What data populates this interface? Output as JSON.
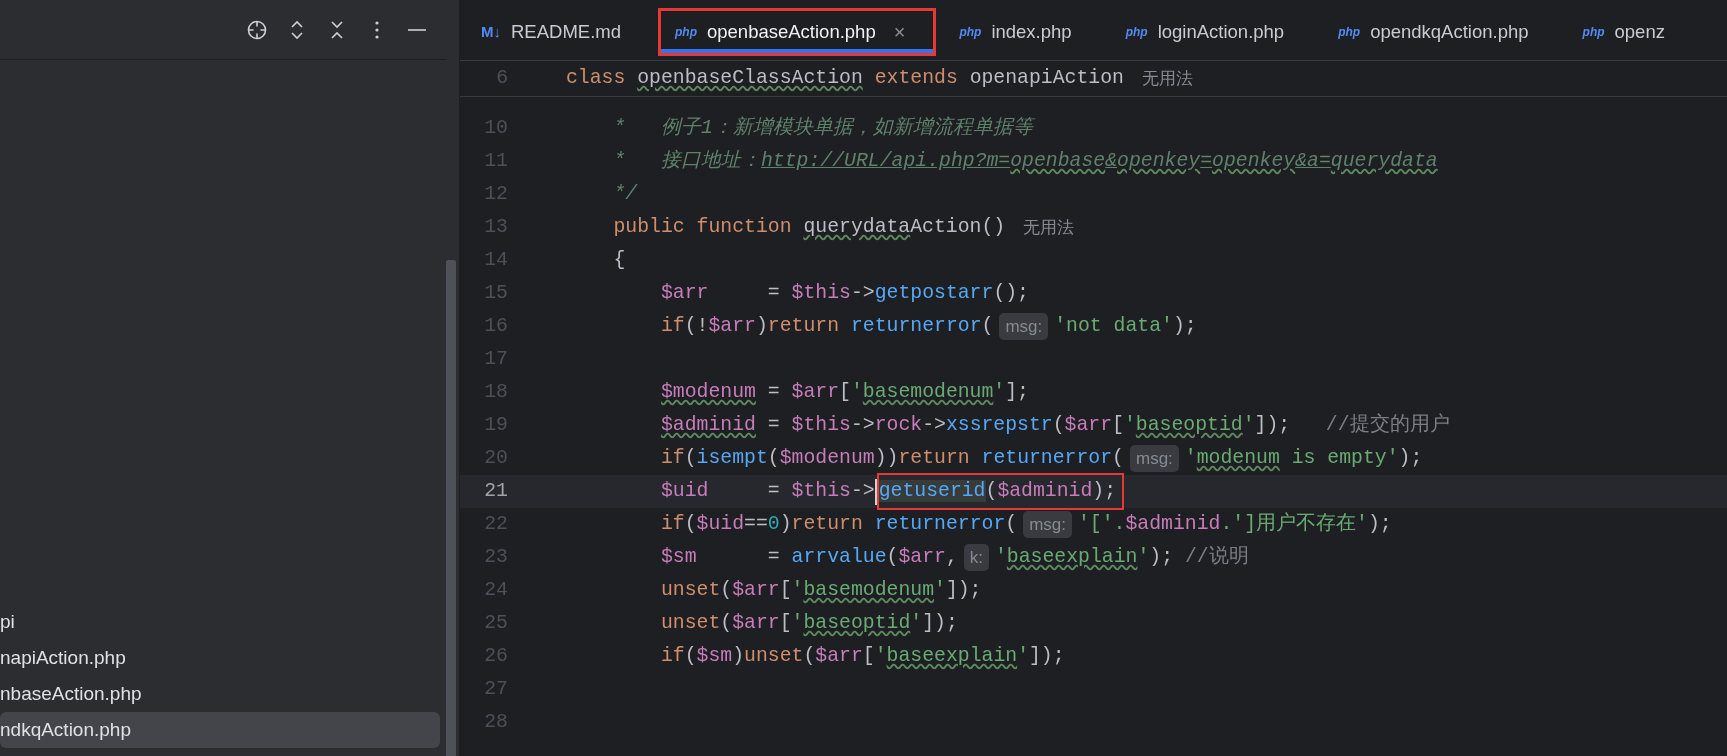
{
  "sidebar": {
    "items": [
      {
        "label": "pi",
        "selected": false
      },
      {
        "label": "napiAction.php",
        "selected": false
      },
      {
        "label": "nbaseAction.php",
        "selected": false
      },
      {
        "label": "ndkqAction.php",
        "selected": true
      }
    ]
  },
  "tabs": [
    {
      "badge": "M↓",
      "label": "README.md",
      "selected": false,
      "highlighted": false
    },
    {
      "badge": "php",
      "label": "openbaseAction.php",
      "selected": true,
      "highlighted": true,
      "close": "×"
    },
    {
      "badge": "php",
      "label": "index.php",
      "selected": false,
      "highlighted": false
    },
    {
      "badge": "php",
      "label": "loginAction.php",
      "selected": false,
      "highlighted": false
    },
    {
      "badge": "php",
      "label": "opendkqAction.php",
      "selected": false,
      "highlighted": false
    },
    {
      "badge": "php",
      "label": "openz",
      "selected": false,
      "highlighted": false
    }
  ],
  "editor": {
    "sticky_line": {
      "number": "6",
      "segments": [
        {
          "kind": "code",
          "tokens": [
            {
              "kind": "keyword",
              "text": "class "
            },
            {
              "kind": "plain",
              "text": "openbaseClassAction",
              "flagged": true
            },
            {
              "kind": "keyword",
              "text": " extends "
            },
            {
              "kind": "plain",
              "text": "openapiAction"
            }
          ]
        },
        {
          "kind": "usage",
          "text": "无用法"
        }
      ]
    },
    "lines": [
      {
        "number": "10",
        "current": false,
        "segments": [
          {
            "kind": "code",
            "tokens": [
              {
                "kind": "doc",
                "text": "*   例子1：新增模块单据，如新增流程单据等"
              }
            ]
          }
        ]
      },
      {
        "number": "11",
        "current": false,
        "segments": [
          {
            "kind": "code",
            "tokens": [
              {
                "kind": "doc",
                "text": "*   接口地址："
              },
              {
                "kind": "doclink",
                "text": "http://URL/api.php?m="
              },
              {
                "kind": "doclink",
                "text": "openbase",
                "flagged": true
              },
              {
                "kind": "doclink",
                "text": "&"
              },
              {
                "kind": "doclink",
                "text": "openkey",
                "flagged": true
              },
              {
                "kind": "doclink",
                "text": "="
              },
              {
                "kind": "doclink",
                "text": "openkey",
                "flagged": true
              },
              {
                "kind": "doclink",
                "text": "&a="
              },
              {
                "kind": "doclink",
                "text": "querydata",
                "flagged": true
              }
            ]
          }
        ]
      },
      {
        "number": "12",
        "current": false,
        "segments": [
          {
            "kind": "code",
            "tokens": [
              {
                "kind": "doc",
                "text": "*/"
              }
            ]
          }
        ]
      },
      {
        "number": "13",
        "current": false,
        "segments": [
          {
            "kind": "code",
            "tokens": [
              {
                "kind": "keyword",
                "text": "public function "
              },
              {
                "kind": "plain",
                "text": "querydata",
                "flagged": true
              },
              {
                "kind": "plain",
                "text": "Action()"
              }
            ]
          },
          {
            "kind": "usage",
            "text": "无用法"
          }
        ]
      },
      {
        "number": "14",
        "current": false,
        "segments": [
          {
            "kind": "code",
            "tokens": [
              {
                "kind": "plain",
                "text": "{"
              }
            ]
          }
        ],
        "children": [
          {
            "number": "15",
            "current": false,
            "segments": [
              {
                "kind": "code",
                "tokens": [
                  {
                    "kind": "var",
                    "text": "$arr"
                  },
                  {
                    "kind": "plain",
                    "text": "     = "
                  },
                  {
                    "kind": "var",
                    "text": "$this"
                  },
                  {
                    "kind": "plain",
                    "text": "->"
                  },
                  {
                    "kind": "fn",
                    "text": "getpostarr"
                  },
                  {
                    "kind": "plain",
                    "text": "();"
                  }
                ]
              }
            ]
          },
          {
            "number": "16",
            "current": false,
            "segments": [
              {
                "kind": "code",
                "tokens": [
                  {
                    "kind": "keyword",
                    "text": "if"
                  },
                  {
                    "kind": "plain",
                    "text": "(!"
                  },
                  {
                    "kind": "var",
                    "text": "$arr"
                  },
                  {
                    "kind": "plain",
                    "text": ")"
                  },
                  {
                    "kind": "keyword",
                    "text": "return "
                  },
                  {
                    "kind": "fn",
                    "text": "returnerror"
                  },
                  {
                    "kind": "plain",
                    "text": "("
                  }
                ]
              },
              {
                "kind": "inlay",
                "text": "msg:"
              },
              {
                "kind": "code",
                "tokens": [
                  {
                    "kind": "str",
                    "text": "'not data'"
                  },
                  {
                    "kind": "plain",
                    "text": ");"
                  }
                ]
              }
            ]
          },
          {
            "number": "17",
            "current": false
          },
          {
            "number": "18",
            "current": false,
            "segments": [
              {
                "kind": "code",
                "tokens": [
                  {
                    "kind": "var",
                    "text": "$modenum",
                    "flagged": true
                  },
                  {
                    "kind": "plain",
                    "text": " = "
                  },
                  {
                    "kind": "var",
                    "text": "$arr"
                  },
                  {
                    "kind": "plain",
                    "text": "["
                  },
                  {
                    "kind": "str",
                    "text": "'"
                  },
                  {
                    "kind": "str",
                    "text": "basemodenum",
                    "flagged": true
                  },
                  {
                    "kind": "str",
                    "text": "'"
                  },
                  {
                    "kind": "plain",
                    "text": "];"
                  }
                ]
              }
            ]
          },
          {
            "number": "19",
            "current": false,
            "segments": [
              {
                "kind": "code",
                "tokens": [
                  {
                    "kind": "var",
                    "text": "$adminid",
                    "flagged": true
                  },
                  {
                    "kind": "plain",
                    "text": " = "
                  },
                  {
                    "kind": "var",
                    "text": "$this"
                  },
                  {
                    "kind": "plain",
                    "text": "->"
                  },
                  {
                    "kind": "var",
                    "text": "rock"
                  },
                  {
                    "kind": "plain",
                    "text": "->"
                  },
                  {
                    "kind": "fn",
                    "text": "xssrepstr"
                  },
                  {
                    "kind": "plain",
                    "text": "("
                  },
                  {
                    "kind": "var",
                    "text": "$arr"
                  },
                  {
                    "kind": "plain",
                    "text": "["
                  },
                  {
                    "kind": "str",
                    "text": "'"
                  },
                  {
                    "kind": "str",
                    "text": "baseoptid",
                    "flagged": true
                  },
                  {
                    "kind": "str",
                    "text": "'"
                  },
                  {
                    "kind": "plain",
                    "text": "]);   "
                  },
                  {
                    "kind": "comment",
                    "text": "//提交的用户"
                  }
                ]
              }
            ]
          },
          {
            "number": "20",
            "current": false,
            "segments": [
              {
                "kind": "code",
                "tokens": [
                  {
                    "kind": "keyword",
                    "text": "if"
                  },
                  {
                    "kind": "plain",
                    "text": "("
                  },
                  {
                    "kind": "fn",
                    "text": "isempt"
                  },
                  {
                    "kind": "plain",
                    "text": "("
                  },
                  {
                    "kind": "var",
                    "text": "$modenum"
                  },
                  {
                    "kind": "plain",
                    "text": "))"
                  },
                  {
                    "kind": "keyword",
                    "text": "return "
                  },
                  {
                    "kind": "fn",
                    "text": "returnerror"
                  },
                  {
                    "kind": "plain",
                    "text": "("
                  }
                ]
              },
              {
                "kind": "inlay",
                "text": "msg:"
              },
              {
                "kind": "code",
                "tokens": [
                  {
                    "kind": "str",
                    "text": "'"
                  },
                  {
                    "kind": "str",
                    "text": "modenum",
                    "flagged": true
                  },
                  {
                    "kind": "str",
                    "text": " is empty'"
                  },
                  {
                    "kind": "plain",
                    "text": ");"
                  }
                ]
              }
            ]
          },
          {
            "number": "21",
            "current": true,
            "segments": [
              {
                "kind": "code",
                "tokens": [
                  {
                    "kind": "var",
                    "text": "$uid"
                  },
                  {
                    "kind": "plain",
                    "text": "     = "
                  },
                  {
                    "kind": "var",
                    "text": "$this"
                  },
                  {
                    "kind": "plain",
                    "text": "->"
                  }
                ]
              },
              {
                "kind": "code",
                "caret": true,
                "highlighted": true,
                "tokens": [
                  {
                    "kind": "fn",
                    "text": "getuserid",
                    "marked": true
                  },
                  {
                    "kind": "plain",
                    "text": "("
                  },
                  {
                    "kind": "var",
                    "text": "$adminid"
                  },
                  {
                    "kind": "plain",
                    "text": ");"
                  }
                ]
              }
            ]
          },
          {
            "number": "22",
            "current": false,
            "segments": [
              {
                "kind": "code",
                "tokens": [
                  {
                    "kind": "keyword",
                    "text": "if"
                  },
                  {
                    "kind": "plain",
                    "text": "("
                  },
                  {
                    "kind": "var",
                    "text": "$uid"
                  },
                  {
                    "kind": "plain",
                    "text": "=="
                  },
                  {
                    "kind": "num",
                    "text": "0"
                  },
                  {
                    "kind": "plain",
                    "text": ")"
                  },
                  {
                    "kind": "keyword",
                    "text": "return "
                  },
                  {
                    "kind": "fn",
                    "text": "returnerror"
                  },
                  {
                    "kind": "plain",
                    "text": "("
                  }
                ]
              },
              {
                "kind": "inlay",
                "text": "msg:"
              },
              {
                "kind": "code",
                "tokens": [
                  {
                    "kind": "str",
                    "text": "'['."
                  },
                  {
                    "kind": "var",
                    "text": "$adminid"
                  },
                  {
                    "kind": "str",
                    "text": ".']用户不存在'"
                  },
                  {
                    "kind": "plain",
                    "text": ");"
                  }
                ]
              }
            ]
          },
          {
            "number": "23",
            "current": false,
            "segments": [
              {
                "kind": "code",
                "tokens": [
                  {
                    "kind": "var",
                    "text": "$sm"
                  },
                  {
                    "kind": "plain",
                    "text": "      = "
                  },
                  {
                    "kind": "fn",
                    "text": "arrvalue"
                  },
                  {
                    "kind": "plain",
                    "text": "("
                  },
                  {
                    "kind": "var",
                    "text": "$arr"
                  },
                  {
                    "kind": "plain",
                    "text": ","
                  }
                ]
              },
              {
                "kind": "inlay",
                "text": "k:"
              },
              {
                "kind": "code",
                "tokens": [
                  {
                    "kind": "str",
                    "text": "'"
                  },
                  {
                    "kind": "str",
                    "text": "baseexplain",
                    "flagged": true
                  },
                  {
                    "kind": "str",
                    "text": "'"
                  },
                  {
                    "kind": "plain",
                    "text": "); "
                  },
                  {
                    "kind": "comment",
                    "text": "//说明"
                  }
                ]
              }
            ]
          },
          {
            "number": "24",
            "current": false,
            "segments": [
              {
                "kind": "code",
                "tokens": [
                  {
                    "kind": "keyword",
                    "text": "unset"
                  },
                  {
                    "kind": "plain",
                    "text": "("
                  },
                  {
                    "kind": "var",
                    "text": "$arr"
                  },
                  {
                    "kind": "plain",
                    "text": "["
                  },
                  {
                    "kind": "str",
                    "text": "'"
                  },
                  {
                    "kind": "str",
                    "text": "basemodenum",
                    "flagged": true
                  },
                  {
                    "kind": "str",
                    "text": "'"
                  },
                  {
                    "kind": "plain",
                    "text": "]);"
                  }
                ]
              }
            ]
          },
          {
            "number": "25",
            "current": false,
            "segments": [
              {
                "kind": "code",
                "tokens": [
                  {
                    "kind": "keyword",
                    "text": "unset"
                  },
                  {
                    "kind": "plain",
                    "text": "("
                  },
                  {
                    "kind": "var",
                    "text": "$arr"
                  },
                  {
                    "kind": "plain",
                    "text": "["
                  },
                  {
                    "kind": "str",
                    "text": "'"
                  },
                  {
                    "kind": "str",
                    "text": "baseoptid",
                    "flagged": true
                  },
                  {
                    "kind": "str",
                    "text": "'"
                  },
                  {
                    "kind": "plain",
                    "text": "]);"
                  }
                ]
              }
            ]
          },
          {
            "number": "26",
            "current": false,
            "segments": [
              {
                "kind": "code",
                "tokens": [
                  {
                    "kind": "keyword",
                    "text": "if"
                  },
                  {
                    "kind": "plain",
                    "text": "("
                  },
                  {
                    "kind": "var",
                    "text": "$sm"
                  },
                  {
                    "kind": "plain",
                    "text": ")"
                  },
                  {
                    "kind": "keyword",
                    "text": "unset"
                  },
                  {
                    "kind": "plain",
                    "text": "("
                  },
                  {
                    "kind": "var",
                    "text": "$arr"
                  },
                  {
                    "kind": "plain",
                    "text": "["
                  },
                  {
                    "kind": "str",
                    "text": "'"
                  },
                  {
                    "kind": "str",
                    "text": "baseexplain",
                    "flagged": true
                  },
                  {
                    "kind": "str",
                    "text": "'"
                  },
                  {
                    "kind": "plain",
                    "text": "]);"
                  }
                ]
              }
            ]
          },
          {
            "number": "27",
            "current": false
          },
          {
            "number": "28",
            "current": false
          }
        ]
      }
    ]
  }
}
